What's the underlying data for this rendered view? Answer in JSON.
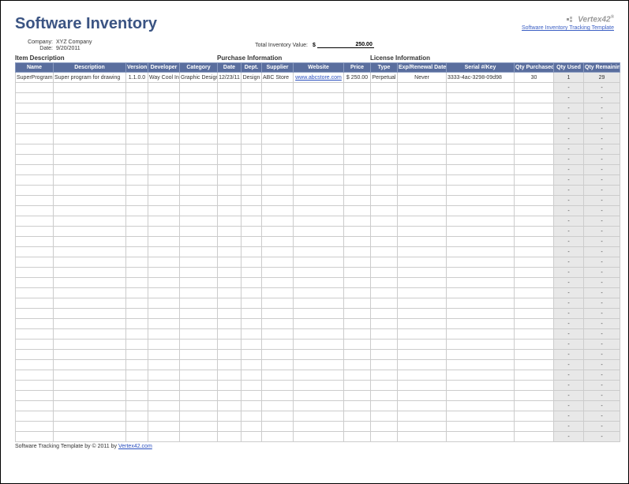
{
  "header": {
    "title": "Software Inventory",
    "logo_text": "Vertex42",
    "template_link": "Software Inventory Tracking Template"
  },
  "meta": {
    "company_label": "Company:",
    "company_value": "XYZ Company",
    "date_label": "Date:",
    "date_value": "9/20/2011"
  },
  "total_inventory": {
    "label": "Total Inventory Value:",
    "currency": "$",
    "value": "250.00"
  },
  "section_labels": {
    "item_desc": "Item Description",
    "purchase": "Purchase Information",
    "license": "License Information"
  },
  "columns": {
    "name": "Name",
    "description": "Description",
    "version": "Version",
    "developer": "Developer",
    "category": "Category",
    "date": "Date",
    "dept": "Dept.",
    "supplier": "Supplier",
    "website": "Website",
    "price": "Price",
    "type": "Type",
    "exp": "Exp/Renewal Date",
    "serial": "Serial #/Key",
    "qty_purchased": "Qty Purchased",
    "qty_used": "Qty Used",
    "qty_remaining": "Qty Remaining"
  },
  "rows": [
    {
      "name": "SuperProgram",
      "description": "Super program for drawing",
      "version": "1.1.0.0",
      "developer": "Way Cool Inc",
      "category": "Graphic Design",
      "date": "12/23/11",
      "dept": "Design",
      "supplier": "ABC Store",
      "website": "www.abcstore.com",
      "price": "$ 250.00",
      "type": "Perpetual",
      "exp": "Never",
      "serial": "3333-4ac-3298-09d98",
      "qty_purchased": "30",
      "qty_used": "1",
      "qty_remaining": "29"
    }
  ],
  "empty_cell": "-",
  "blank_row_count": 35,
  "footer": {
    "text_prefix": "Software Tracking Template by ",
    "copyright": "© 2011 by ",
    "vendor": "Vertex42.com"
  }
}
